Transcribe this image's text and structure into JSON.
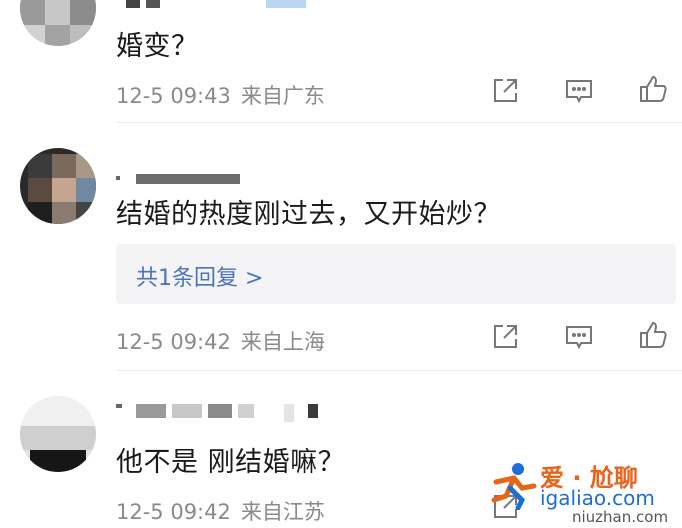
{
  "comments": [
    {
      "text": "婚变？",
      "date": "12-5 09:43",
      "location": "来自广东"
    },
    {
      "text": "结婚的热度刚过去，又开始炒？",
      "reply_link": "共1条回复 >",
      "date": "12-5 09:42",
      "location": "来自上海"
    },
    {
      "text": "他不是 刚结婚嘛？",
      "date": "12-5 09:42",
      "location": "来自江苏"
    }
  ],
  "actions": {
    "share_icon": "share-icon",
    "reply_icon": "comment-icon",
    "like_icon": "thumbs-up-icon"
  },
  "watermark": {
    "brand_cn": "爱 · 尬聊",
    "brand_domain": "igaliao.com",
    "source": "niuzhan.com"
  },
  "colors": {
    "meta_text": "#8a8a8a",
    "link_blue": "#4a73b8",
    "reply_bg": "#f4f4f6",
    "icon": "#777777"
  }
}
